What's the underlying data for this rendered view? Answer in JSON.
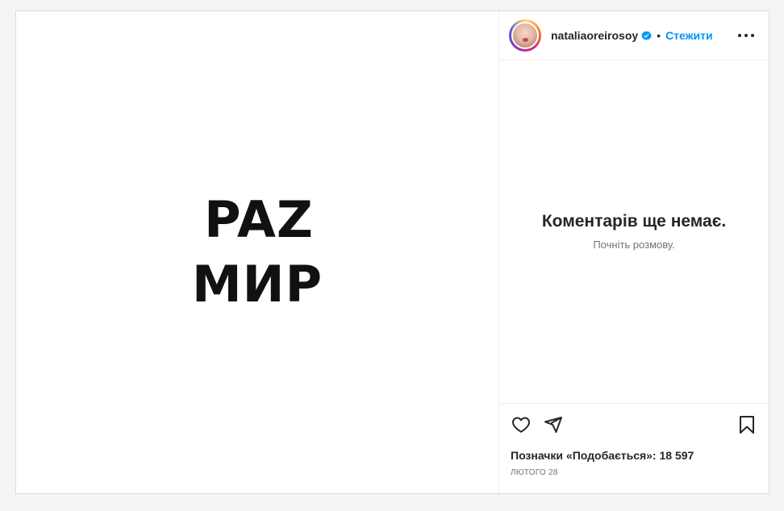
{
  "post": {
    "media": {
      "line1": "PAZ",
      "line2": "МИР"
    }
  },
  "header": {
    "username": "nataliaoreirosoy",
    "separator": "•",
    "follow_label": "Стежити",
    "icons": {
      "avatar": "profile-avatar",
      "verified": "verified-badge-icon",
      "more": "more-options-icon"
    },
    "colors": {
      "follow": "#0095f6",
      "verified": "#0095f6"
    }
  },
  "comments": {
    "empty_title": "Коментарів ще немає.",
    "empty_subtitle": "Почніть розмову."
  },
  "actions": {
    "icons": [
      "heart-icon",
      "share-icon",
      "bookmark-icon"
    ],
    "likes_label": "Позначки «Подобається»: 18 597",
    "date": "лютого 28"
  }
}
